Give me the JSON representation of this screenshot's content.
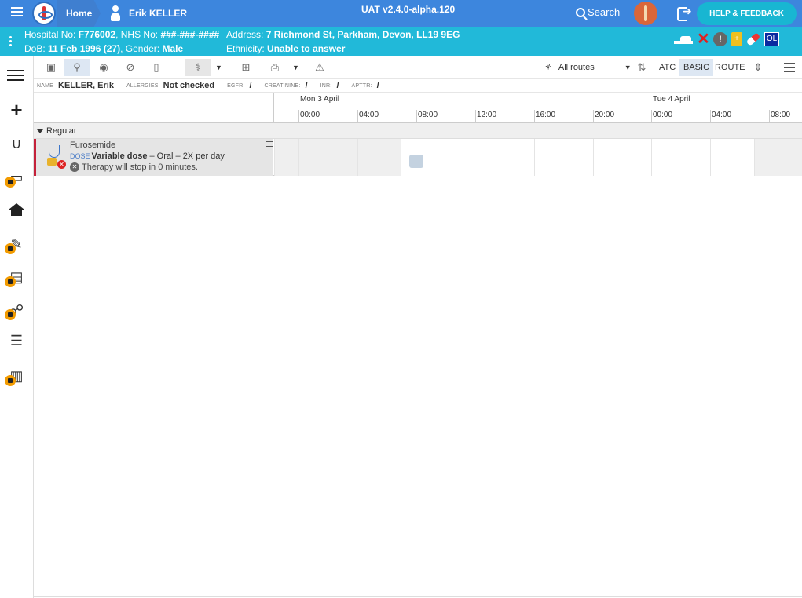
{
  "header": {
    "home_label": "Home",
    "patient_name": "Erik KELLER",
    "version": "UAT v2.4.0-alpha.120",
    "search_label": "Search",
    "help_label": "HELP & FEEDBACK"
  },
  "patient_banner": {
    "line1_prefix": "Hospital No: ",
    "hospital_no": "F776002",
    "nhs_prefix": ", NHS No: ",
    "nhs_no": "###-###-####",
    "address_prefix": "Address: ",
    "address": "7 Richmond St, Parkham, Devon, LL19 9EG",
    "dob_prefix": "DoB: ",
    "dob": "11 Feb 1996 (27)",
    "gender_prefix": ", Gender: ",
    "gender": "Male",
    "ethnicity_prefix": "Ethnicity: ",
    "ethnicity": "Unable to answer",
    "alert_badge": "!",
    "clip_badge": "+",
    "ol_badge": "OL"
  },
  "toolbar": {
    "routes_label": "All routes",
    "atc": "ATC",
    "basic": "BASIC",
    "route": "ROUTE"
  },
  "info_bar": {
    "name_label": "NAME",
    "name": "KELLER, Erik",
    "allergies_label": "ALLERGIES",
    "allergies": "Not checked",
    "egfr_label": "EGFR:",
    "egfr": "/",
    "creatinine_label": "CREATININE:",
    "creatinine": "/",
    "inr_label": "INR:",
    "inr": "/",
    "aptt_label": "APTTR:",
    "aptt": "/"
  },
  "timeline": {
    "day1": "Mon 3 April",
    "day2": "Tue 4 April",
    "hours": [
      "00:00",
      "04:00",
      "08:00",
      "12:00",
      "16:00",
      "20:00",
      "00:00",
      "04:00",
      "08:00"
    ]
  },
  "groups": [
    {
      "label": "Regular",
      "meds": [
        {
          "name": "Furosemide",
          "dose_tag": "DOSE",
          "dose_main": "Variable dose",
          "dose_rest": " – Oral – 2X per day",
          "stop_text": "Therapy will stop in 0 minutes."
        }
      ]
    }
  ],
  "colors": {
    "top_bar": "#3d86dd",
    "patient_bar": "#21b9d9",
    "help_button": "#18b6d2",
    "med_accent": "#c4213a",
    "lock_badge": "#f29b00"
  }
}
